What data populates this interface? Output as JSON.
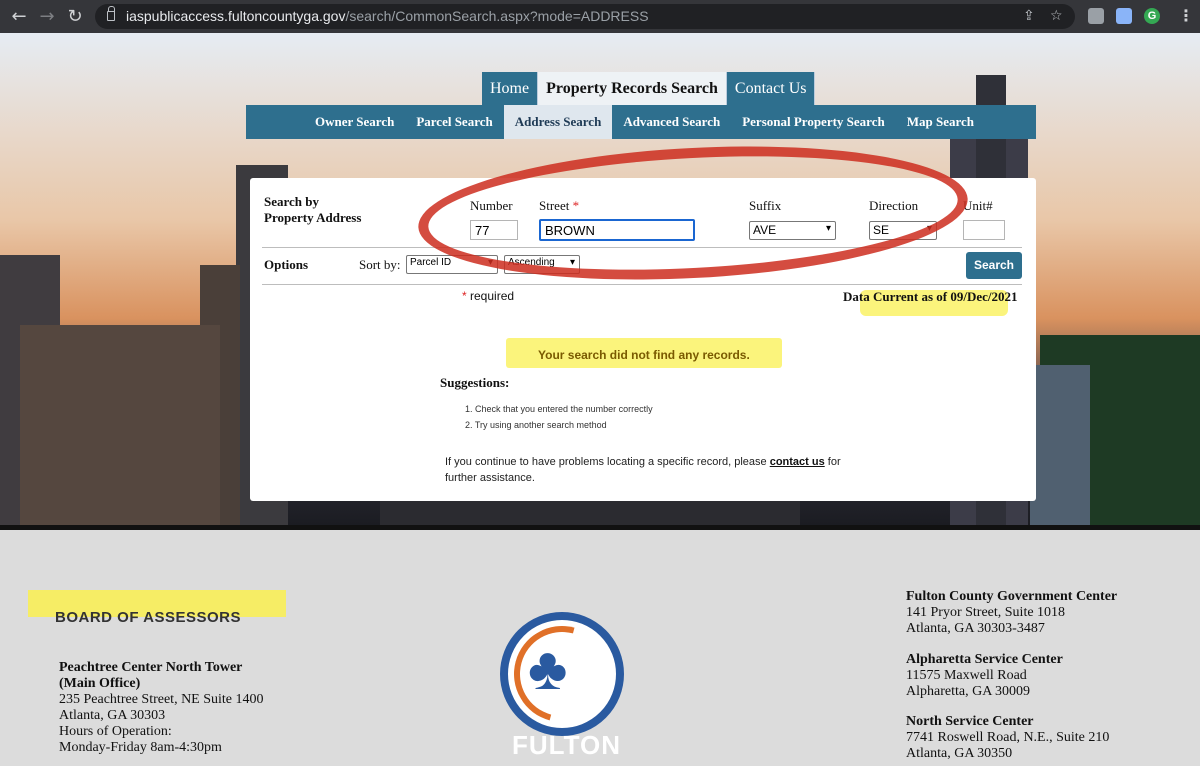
{
  "browser": {
    "url_host": "iaspublicaccess.fultoncountyga.gov",
    "url_path": "/search/CommonSearch.aspx?mode=ADDRESS"
  },
  "top_tabs": [
    {
      "label": "Home"
    },
    {
      "label": "Property Records Search"
    },
    {
      "label": "Contact Us"
    }
  ],
  "sub_tabs": [
    {
      "label": "Owner Search"
    },
    {
      "label": "Parcel Search"
    },
    {
      "label": "Address Search"
    },
    {
      "label": "Advanced Search"
    },
    {
      "label": "Personal Property Search"
    },
    {
      "label": "Map Search"
    }
  ],
  "form": {
    "heading_line1": "Search by",
    "heading_line2": "Property Address",
    "number_label": "Number",
    "street_label": "Street",
    "required_mark": "*",
    "suffix_label": "Suffix",
    "direction_label": "Direction",
    "unit_label": "Unit#",
    "number_value": "77",
    "street_value": "BROWN",
    "suffix_value": "AVE",
    "direction_value": "SE",
    "unit_value": ""
  },
  "options": {
    "label": "Options",
    "sort_by_label": "Sort by:",
    "sort_field": "Parcel ID",
    "sort_order": "Ascending",
    "search_button": "Search"
  },
  "required_note": "required",
  "data_current": "Data Current as of 09/Dec/2021",
  "message": "Your search did not find any records.",
  "suggestions": {
    "title": "Suggestions:",
    "items": [
      "1. Check that you entered the number correctly",
      "2. Try using another search method"
    ]
  },
  "help": {
    "text_before": "If you continue to have problems locating a specific record, please",
    "link": "contact us",
    "text_after": "for",
    "line2": "further assistance."
  },
  "footer": {
    "board_title": "BOARD OF ASSESSORS",
    "main_office": {
      "name1": "Peachtree Center North Tower",
      "name2": "(Main Office)",
      "line1": "235 Peachtree Street, NE Suite 1400",
      "line2": "Atlanta, GA 30303",
      "line3": "Hours of Operation:",
      "line4": "Monday-Friday 8am-4:30pm"
    },
    "logo_text": "FULTON",
    "centers": [
      {
        "name": "Fulton County Government Center",
        "line1": "141 Pryor Street, Suite 1018",
        "line2": "Atlanta, GA 30303-3487"
      },
      {
        "name": "Alpharetta Service Center",
        "line1": "11575 Maxwell Road",
        "line2": "Alpharetta, GA 30009"
      },
      {
        "name": "North Service Center",
        "line1": "7741 Roswell Road, N.E., Suite 210",
        "line2": "Atlanta, GA 30350"
      }
    ]
  },
  "colors": {
    "nav_teal": "#2e6f8e",
    "highlight_yellow": "#faf050",
    "annotation_red": "#cd2d1e"
  }
}
